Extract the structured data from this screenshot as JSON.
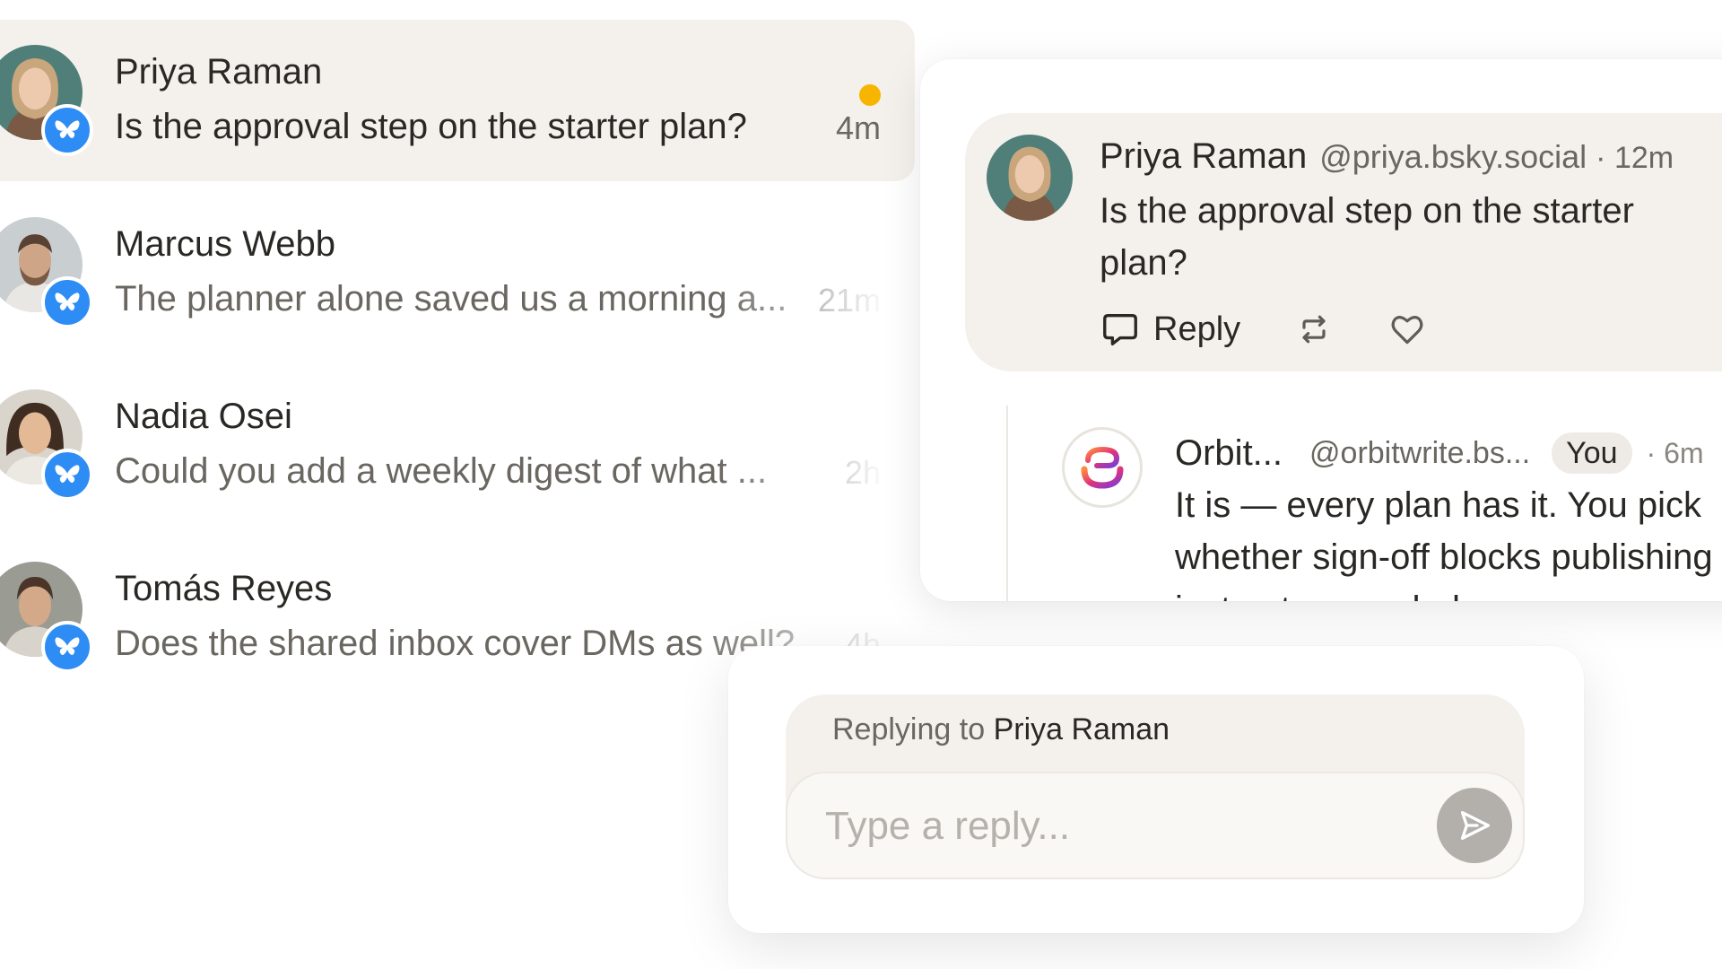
{
  "conversations": [
    {
      "name": "Priya Raman",
      "preview": "Is the approval step on the starter plan?",
      "time": "4m",
      "unread": true
    },
    {
      "name": "Marcus Webb",
      "preview": "The planner alone saved us a morning a...",
      "time": "21m",
      "unread": false
    },
    {
      "name": "Nadia Osei",
      "preview": "Could you add a weekly digest of what ...",
      "time": "2h",
      "unread": false
    },
    {
      "name": "Tomás Reyes",
      "preview": "Does the shared inbox cover DMs as well?",
      "time": "4h",
      "unread": false
    }
  ],
  "thread": {
    "post": {
      "author": "Priya Raman",
      "handle": "@priya.bsky.social",
      "time": "· 12m",
      "text": "Is the approval step on the starter plan?",
      "reply_label": "Reply"
    },
    "reply": {
      "author": "Orbit...",
      "handle": "@orbitwrite.bs...",
      "badge": "You",
      "time": "· 6m",
      "text": "It is — every plan has it. You pick whether sign-off blocks publishing or just gets recorded."
    }
  },
  "composer": {
    "replying_prefix": "Replying to",
    "replying_name": "Priya Raman",
    "placeholder": "Type a reply..."
  },
  "colors": {
    "accent_unread": "#f7b500",
    "bluesky_badge": "#2e8cf5",
    "active_row_bg": "#f4f1ed",
    "send_button": "#b3b0ab"
  },
  "icons": {
    "platform": "bluesky-butterfly-icon",
    "reply": "speech-bubble-icon",
    "repost": "repost-icon",
    "like": "heart-icon",
    "send": "send-arrow-icon"
  }
}
